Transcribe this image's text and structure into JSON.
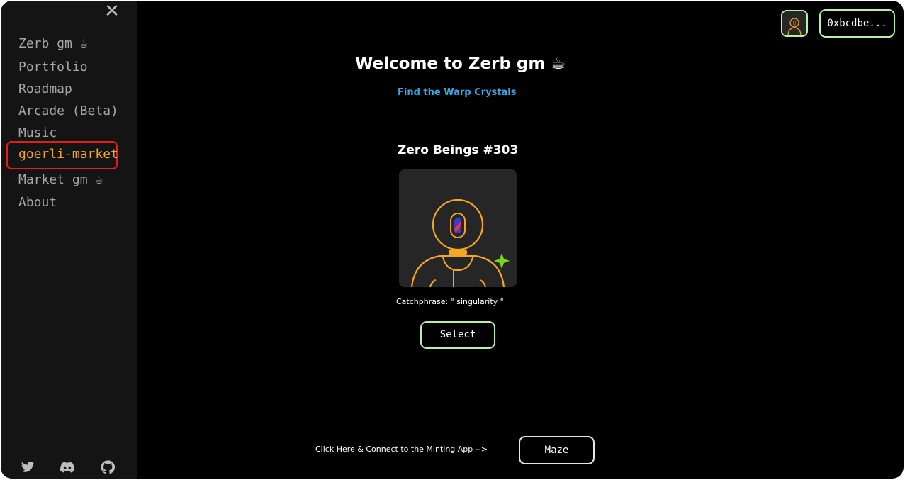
{
  "sidebar": {
    "close_icon": "close-icon",
    "items": [
      {
        "label": "Zerb gm ☕",
        "active": false
      },
      {
        "label": "Portfolio",
        "active": false
      },
      {
        "label": "Roadmap",
        "active": false
      },
      {
        "label": "Arcade (Beta)",
        "active": false
      },
      {
        "label": "Music",
        "active": false
      },
      {
        "label": "goerli-market",
        "active": true
      },
      {
        "label": "Market gm ☕",
        "active": false
      },
      {
        "label": "About",
        "active": false
      }
    ],
    "social": [
      "twitter-icon",
      "discord-icon",
      "github-icon"
    ]
  },
  "header": {
    "wallet_address": "0xbcdbe..."
  },
  "main": {
    "title": "Welcome to Zerb gm ☕",
    "subtitle_link": "Find the Warp Crystals",
    "nft": {
      "name": "Zero Beings #303",
      "catchphrase": "Catchphrase: \" singularity \"",
      "select_label": "Select"
    },
    "footer": {
      "text": "Click Here & Connect to the Minting App -->",
      "button_label": "Maze"
    }
  },
  "colors": {
    "accent_orange": "#f5a623",
    "link_blue": "#3aa6e0",
    "button_border": "#b8f0a8",
    "active_box": "#e11d1d",
    "sidebar_bg": "#141414",
    "main_bg": "#000000"
  }
}
